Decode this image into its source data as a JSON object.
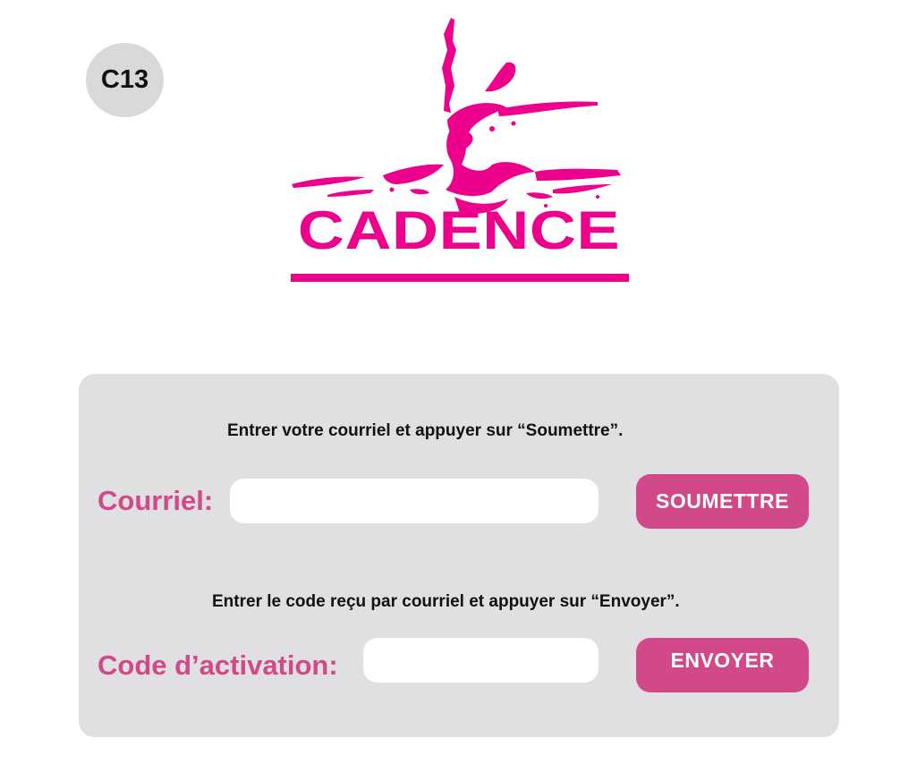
{
  "screen": {
    "id_badge": "C13"
  },
  "logo": {
    "text": "CADENCE",
    "brand_color": "#ec008c"
  },
  "form": {
    "email_instruction": "Entrer votre courriel et appuyer sur “Soumettre”.",
    "email_label": "Courriel:",
    "email_value": "",
    "submit_label": "SOUMETTRE",
    "code_instruction": "Entrer le code reçu par courriel et appuyer sur “Envoyer”.",
    "code_label": "Code d’activation:",
    "code_value": "",
    "send_label": "ENVOYER",
    "accent_color": "#d2498a",
    "panel_color": "#e0dfe1"
  }
}
